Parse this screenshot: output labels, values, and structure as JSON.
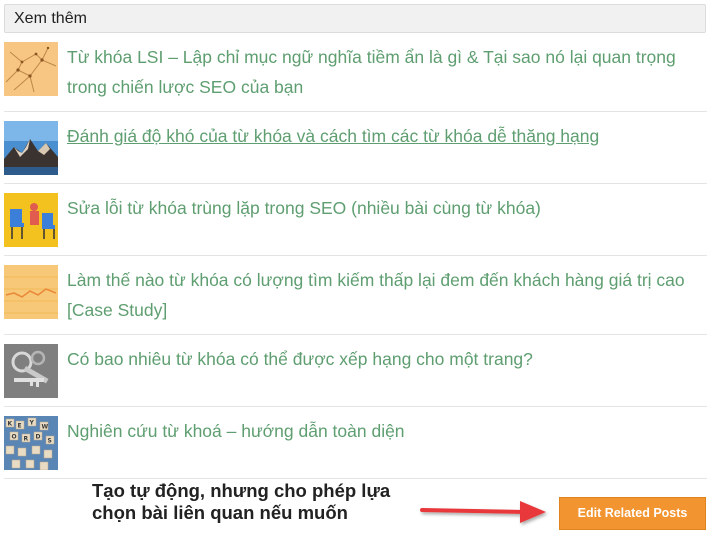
{
  "header": {
    "title": "Xem thêm"
  },
  "posts": [
    {
      "title": "Từ khóa LSI – Lập chỉ mục ngữ nghĩa tiềm ẩn là gì & Tại sao nó lại quan trọng trong chiến lược SEO của bạn",
      "thumb_icon": "network-thumbnail"
    },
    {
      "title": "Đánh giá độ khó của từ khóa và cách tìm các từ khóa dễ thăng hạng",
      "thumb_icon": "mountain-thumbnail"
    },
    {
      "title": "Sửa lỗi từ khóa trùng lặp trong SEO (nhiều bài cùng từ khóa)",
      "thumb_icon": "chairs-thumbnail"
    },
    {
      "title": "Làm thế nào từ khóa có lượng tìm kiếm thấp lại đem đến khách hàng giá trị cao [Case Study]",
      "thumb_icon": "chart-thumbnail"
    },
    {
      "title": "Có bao nhiêu từ khóa có thể được xếp hạng cho một trang?",
      "thumb_icon": "keys-thumbnail"
    },
    {
      "title": "Nghiên cứu từ khoá – hướng dẫn toàn diện",
      "thumb_icon": "letter-tiles-thumbnail"
    }
  ],
  "note": {
    "text": "Tạo tự động, nhưng cho phép lựa chọn bài liên quan nếu muốn"
  },
  "button": {
    "label": "Edit Related Posts"
  },
  "colors": {
    "link": "#5e9e70",
    "button": "#f29530",
    "arrow": "#e8393a",
    "header_bg": "#f1f1f1"
  }
}
